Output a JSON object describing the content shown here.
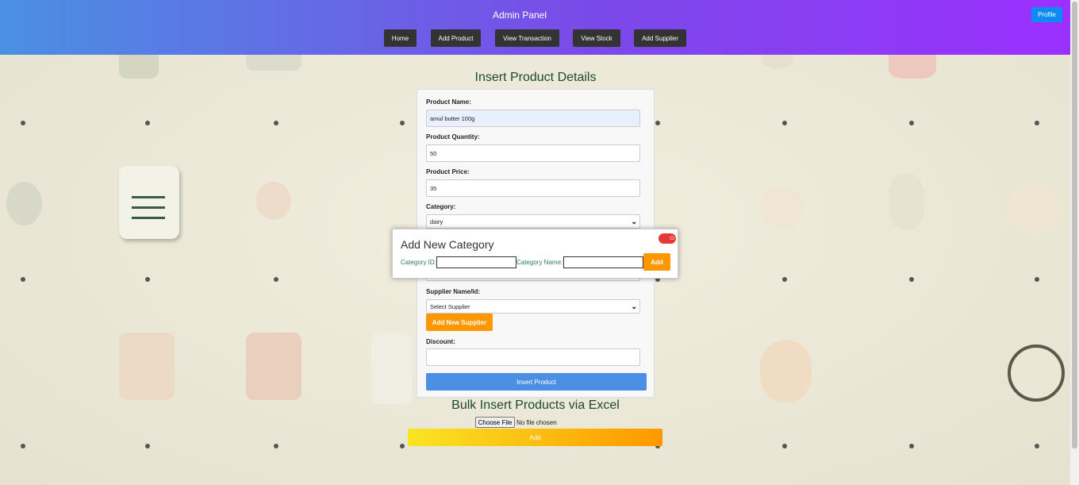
{
  "header": {
    "title": "Admin Panel",
    "profile_label": "Profile",
    "nav": [
      "Home",
      "Add Product",
      "View Transaction",
      "View Stock",
      "Add Supplier"
    ]
  },
  "form": {
    "title": "Insert Product Details",
    "product_name_label": "Product Name:",
    "product_name_value": "amul butter 100g",
    "quantity_label": "Product Quantity:",
    "quantity_value": "50",
    "price_label": "Product Price:",
    "price_value": "35",
    "category_label": "Category:",
    "category_value": "dairy",
    "supplier_label": "Supplier Name/Id:",
    "supplier_value": "Select Supplier",
    "add_supplier_label": "Add New Supplier",
    "discount_label": "Discount:",
    "discount_value": "",
    "submit_label": "Insert Product"
  },
  "modal": {
    "title": "Add New Category",
    "id_label": "Category ID:",
    "name_label": "Category Name:",
    "add_label": "Add",
    "close_label": "Cl"
  },
  "bulk": {
    "title": "Bulk Insert Products via Excel",
    "choose_file_label": "Choose File",
    "no_file_text": "No file chosen",
    "add_label": "Add"
  },
  "colors": {
    "header_start": "#4a90e2",
    "header_end": "#9b30ff",
    "accent_orange": "#ff9800",
    "accent_blue": "#4a8fe3",
    "title_green": "#1c4a2e"
  }
}
